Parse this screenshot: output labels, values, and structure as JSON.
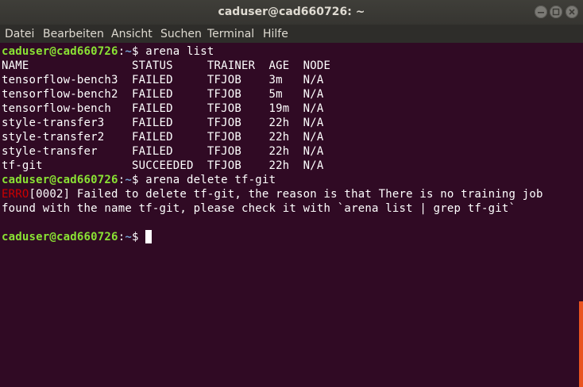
{
  "window": {
    "title": "caduser@cad660726: ~"
  },
  "menubar": {
    "items": [
      "Datei",
      "Bearbeiten",
      "Ansicht",
      "Suchen",
      "Terminal",
      "Hilfe"
    ]
  },
  "terminal": {
    "prompt_user": "caduser@cad660726",
    "prompt_sep": ":",
    "prompt_path": "~",
    "prompt_dollar": "$ ",
    "cmd1": "arena list",
    "table_header": "NAME               STATUS     TRAINER  AGE  NODE",
    "rows": [
      "tensorflow-bench3  FAILED     TFJOB    3m   N/A",
      "tensorflow-bench2  FAILED     TFJOB    5m   N/A",
      "tensorflow-bench   FAILED     TFJOB    19m  N/A",
      "style-transfer3    FAILED     TFJOB    22h  N/A",
      "style-transfer2    FAILED     TFJOB    22h  N/A",
      "style-transfer     FAILED     TFJOB    22h  N/A",
      "tf-git             SUCCEEDED  TFJOB    22h  N/A"
    ],
    "cmd2": "arena delete tf-git",
    "error_tag": "ERRO",
    "error_rest": "[0002] Failed to delete tf-git, the reason is that There is no training job",
    "error_line2": "found with the name tf-git, please check it with `arena list | grep tf-git`"
  },
  "colors": {
    "terminal_bg": "#300a24",
    "prompt_user": "#8ae234",
    "prompt_path": "#729fcf",
    "error": "#cc0000",
    "scrollbar": "#e95420"
  }
}
